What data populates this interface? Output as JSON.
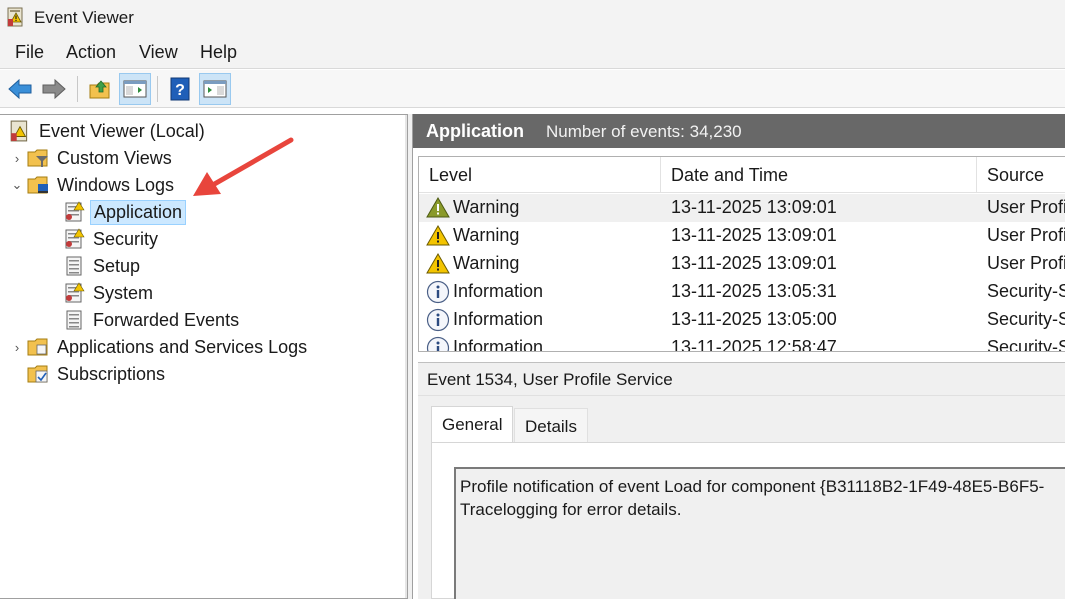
{
  "window": {
    "title": "Event Viewer",
    "icon": "event-viewer-icon"
  },
  "menu": [
    "File",
    "Action",
    "View",
    "Help"
  ],
  "toolbar": {
    "buttons": [
      {
        "name": "back-button",
        "icon": "arrow-left-icon"
      },
      {
        "name": "forward-button",
        "icon": "arrow-right-icon"
      },
      {
        "name": "up-folder-button",
        "icon": "folder-up-icon"
      },
      {
        "name": "show-hide-console-tree-button",
        "icon": "console-tree-icon",
        "active": true
      },
      {
        "name": "help-button",
        "icon": "help-icon"
      },
      {
        "name": "show-hide-action-pane-button",
        "icon": "action-pane-icon",
        "active": true
      }
    ]
  },
  "tree": {
    "root": "Event Viewer (Local)",
    "custom_views": "Custom Views",
    "windows_logs": "Windows Logs",
    "application": "Application",
    "security": "Security",
    "setup": "Setup",
    "system": "System",
    "forwarded_events": "Forwarded Events",
    "apps_services_logs": "Applications and Services Logs",
    "subscriptions": "Subscriptions"
  },
  "log": {
    "name": "Application",
    "count_text": "Number of events: 34,230"
  },
  "grid": {
    "columns": [
      "Level",
      "Date and Time",
      "Source"
    ],
    "rows": [
      {
        "level": "Warning",
        "date": "13-11-2025 13:09:01",
        "source": "User Profil",
        "type": "warning"
      },
      {
        "level": "Warning",
        "date": "13-11-2025 13:09:01",
        "source": "User Profil",
        "type": "warning"
      },
      {
        "level": "Warning",
        "date": "13-11-2025 13:09:01",
        "source": "User Profil",
        "type": "warning"
      },
      {
        "level": "Information",
        "date": "13-11-2025 13:05:31",
        "source": "Security-S",
        "type": "info"
      },
      {
        "level": "Information",
        "date": "13-11-2025 13:05:00",
        "source": "Security-S",
        "type": "info"
      },
      {
        "level": "Information",
        "date": "13-11-2025 12:58:47",
        "source": "Security-S",
        "type": "info"
      }
    ]
  },
  "detail": {
    "title": "Event 1534, User Profile Service",
    "tabs": [
      "General",
      "Details"
    ],
    "description_line1": "Profile notification of event Load for component {B31118B2-1F49-48E5-B6F5-",
    "description_line2": "Tracelogging for error details."
  },
  "annotation": {
    "arrow_color": "#e8453c"
  }
}
